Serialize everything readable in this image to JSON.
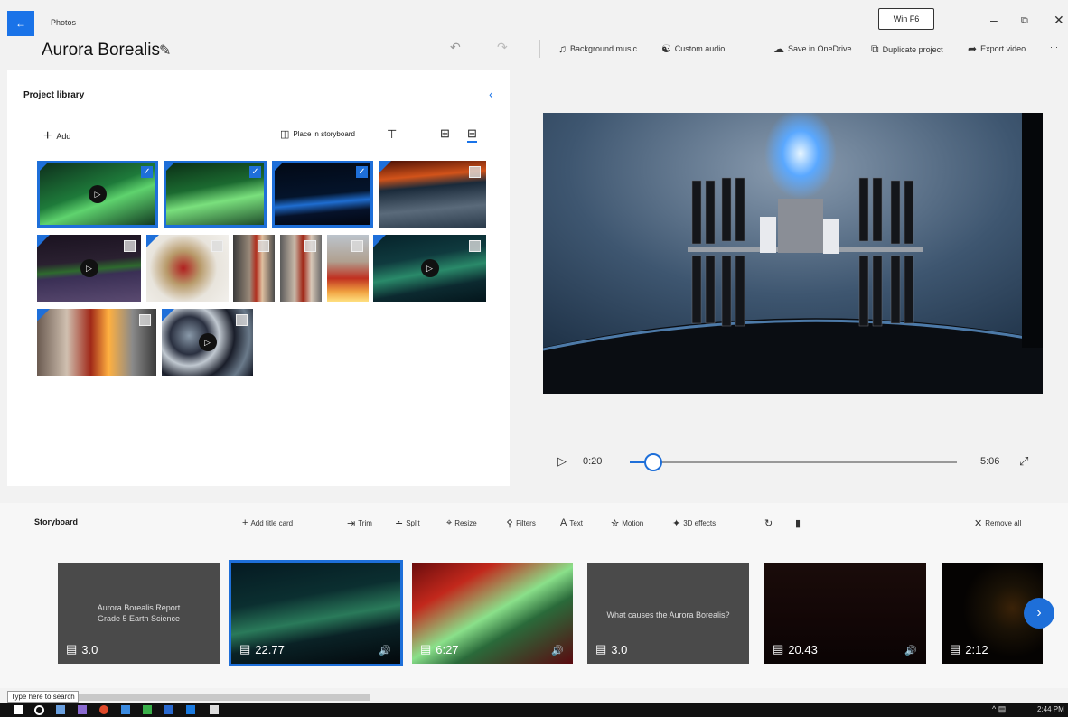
{
  "app": {
    "name": "Photos",
    "project_title": "Aurora Borealis"
  },
  "titlebar": {
    "background_music": "Background music",
    "custom_audio": "Custom audio",
    "save_onedrive": "Save in OneDrive",
    "duplicate": "Duplicate project",
    "export": "Export video",
    "more": "···",
    "window_badge": "Win F6"
  },
  "library": {
    "title": "Project library",
    "add": "Add",
    "place": "Place in storyboard"
  },
  "player": {
    "current_time": "0:20",
    "total_time": "5:06",
    "progress_fraction": 0.07
  },
  "storyboard": {
    "title": "Storyboard",
    "add_title_card": "Add title card",
    "trim": "Trim",
    "split": "Split",
    "resize": "Resize",
    "filters": "Filters",
    "text": "Text",
    "motion": "Motion",
    "effects": "3D effects",
    "remove_all": "Remove all",
    "cards": [
      {
        "caption": "Aurora Borealis Report\nGrade 5 Earth Science",
        "duration": "3.0"
      },
      {
        "caption": "",
        "duration": "22.77"
      },
      {
        "caption": "",
        "duration": "6:27"
      },
      {
        "caption": "What causes the Aurora Borealis?",
        "duration": "3.0"
      },
      {
        "caption": "",
        "duration": "20.43"
      },
      {
        "caption": "",
        "duration": "2:12"
      }
    ]
  },
  "taskbar": {
    "search_placeholder": "Type here to search",
    "time": "2:44 PM"
  }
}
